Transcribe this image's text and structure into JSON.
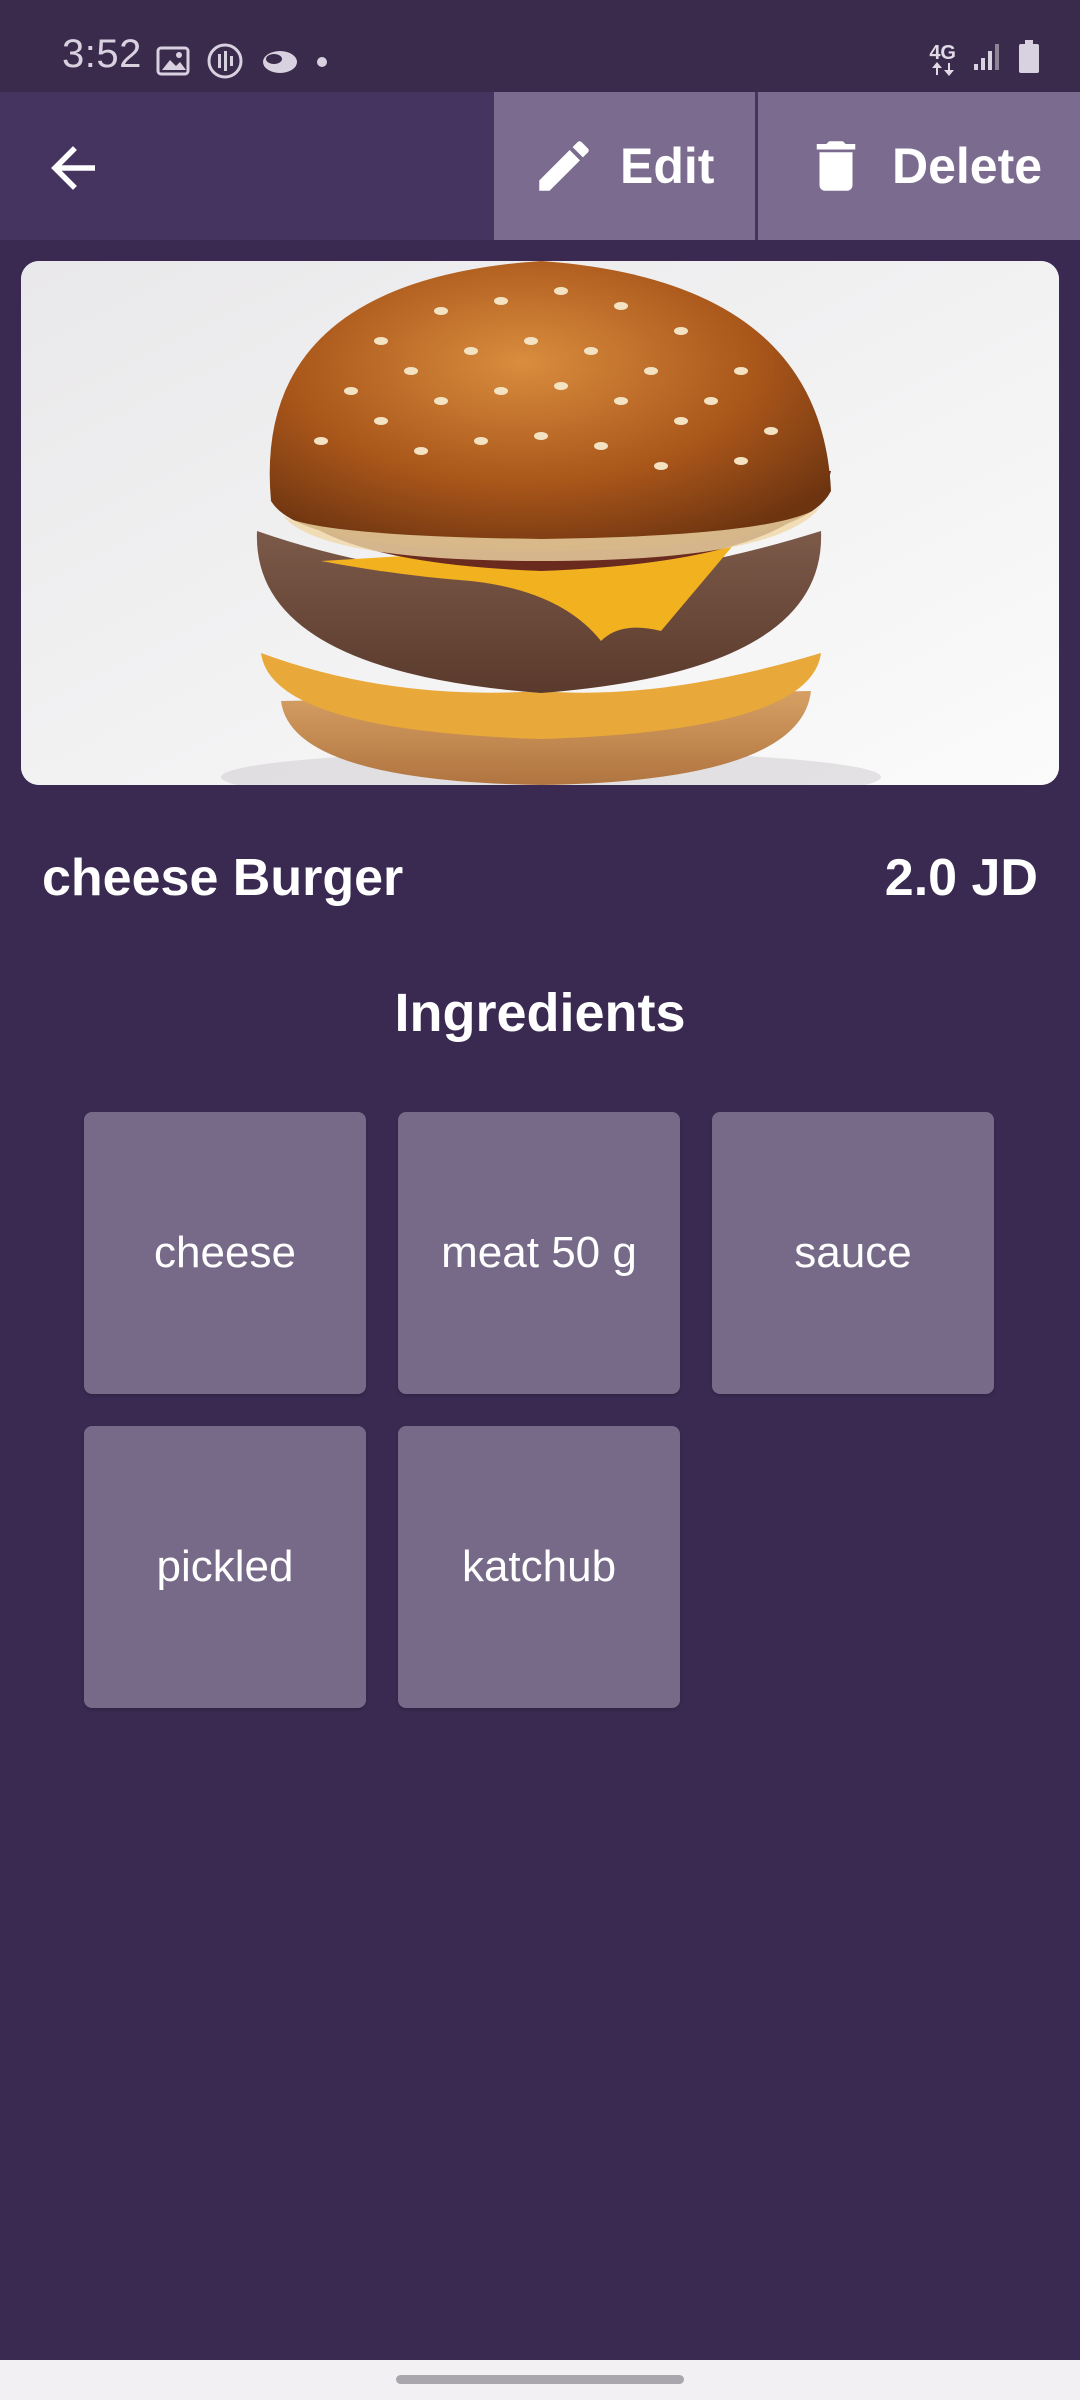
{
  "status_bar": {
    "time": "3:52",
    "network": "4G",
    "icons_left": [
      "gallery-icon",
      "podcast-icon",
      "cloud-icon",
      "notification-dot-icon"
    ],
    "icons_right": [
      "network-4g-icon",
      "signal-icon",
      "battery-icon"
    ]
  },
  "app_bar": {
    "back_icon": "arrow-back-icon",
    "edit_label": "Edit",
    "edit_icon": "pencil-icon",
    "delete_label": "Delete",
    "delete_icon": "trash-icon"
  },
  "item": {
    "name": "cheese Burger",
    "price": "2.0 JD",
    "image": "burger-photo"
  },
  "ingredients": {
    "title": "Ingredients",
    "items": [
      "cheese",
      "meat 50 g",
      "sauce",
      "pickled",
      "katchub"
    ]
  },
  "colors": {
    "background": "#3a2a52",
    "app_bar": "#45345f",
    "action_button": "#7b6b8f",
    "ingredient_card": "#766a88"
  }
}
